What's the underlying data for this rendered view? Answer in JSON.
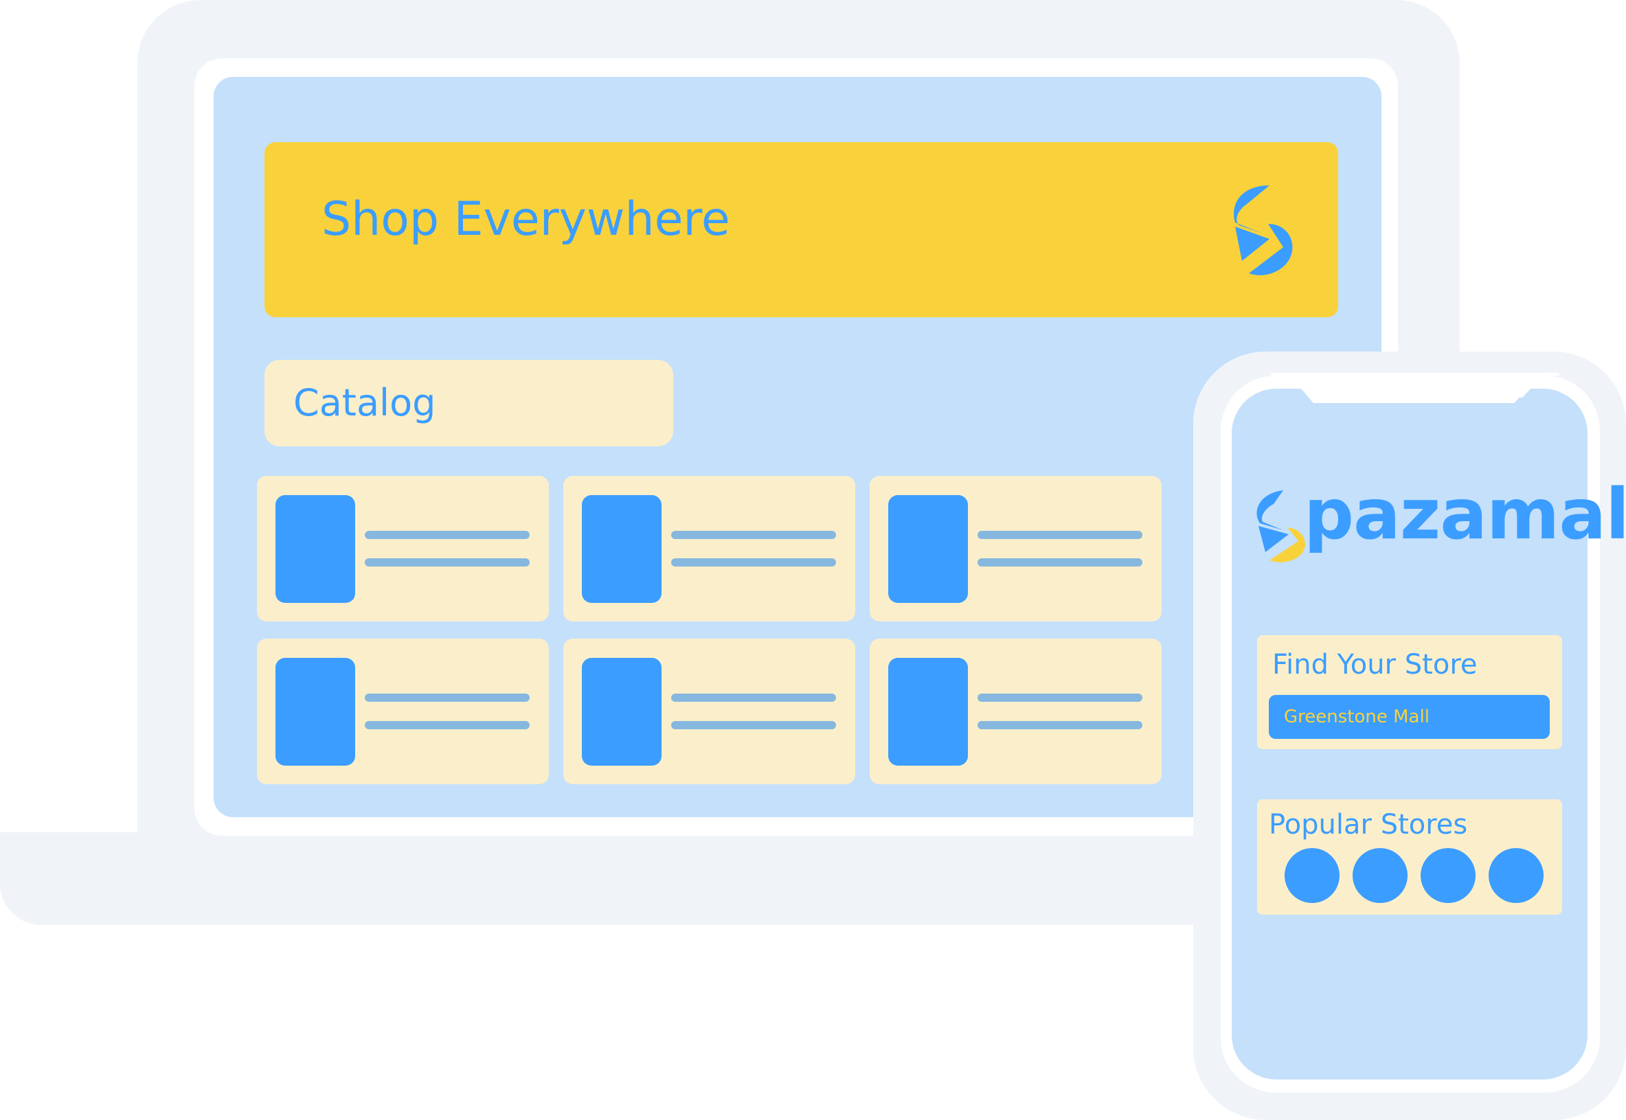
{
  "colors": {
    "primary_blue": "#3b9dff",
    "yellow": "#f9d23b",
    "cream": "#fbefcb",
    "screen_bg": "#c4e0fb",
    "device_frame": "#f0f4f8",
    "text_line": "#86b8df"
  },
  "laptop": {
    "hero": {
      "title": "Shop Everywhere",
      "logo_icon": "spazamall-logo-icon"
    },
    "catalog": {
      "label": "Catalog",
      "products": [
        {
          "thumbnail_icon": "product-image-placeholder"
        },
        {
          "thumbnail_icon": "product-image-placeholder"
        },
        {
          "thumbnail_icon": "product-image-placeholder"
        },
        {
          "thumbnail_icon": "product-image-placeholder"
        },
        {
          "thumbnail_icon": "product-image-placeholder"
        },
        {
          "thumbnail_icon": "product-image-placeholder"
        }
      ]
    }
  },
  "phone": {
    "brand": {
      "name": "pazamall",
      "logo_icon": "spazamall-logo-icon"
    },
    "find_store": {
      "title": "Find Your Store",
      "selected_value": "Greenstone Mall"
    },
    "popular_stores": {
      "title": "Popular Stores",
      "count": 4
    }
  }
}
